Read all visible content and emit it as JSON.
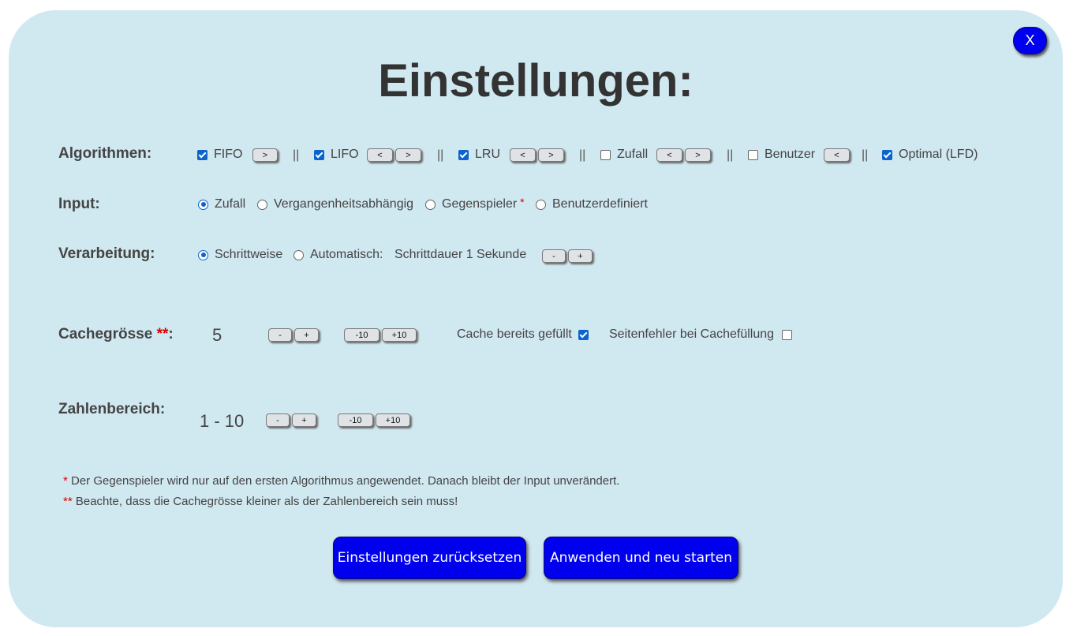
{
  "dialog": {
    "close_label": "X",
    "title": "Einstellungen:"
  },
  "algorithms": {
    "label": "Algorithmen:",
    "separator": "||",
    "items": [
      {
        "label": "FIFO",
        "checked": true,
        "buttons": [
          ">"
        ]
      },
      {
        "label": "LIFO",
        "checked": true,
        "buttons": [
          "<",
          ">"
        ]
      },
      {
        "label": "LRU",
        "checked": true,
        "buttons": [
          "<",
          ">"
        ]
      },
      {
        "label": "Zufall",
        "checked": false,
        "buttons": [
          "<",
          ">"
        ]
      },
      {
        "label": "Benutzer",
        "checked": false,
        "buttons": [
          "<"
        ]
      },
      {
        "label": "Optimal (LFD)",
        "checked": true,
        "buttons": []
      }
    ]
  },
  "input": {
    "label": "Input:",
    "options": [
      {
        "label": "Zufall",
        "selected": true
      },
      {
        "label": "Vergangenheitsabhängig",
        "selected": false
      },
      {
        "label": "Gegenspieler",
        "selected": false,
        "marker": "*"
      },
      {
        "label": "Benutzerdefiniert",
        "selected": false
      }
    ]
  },
  "processing": {
    "label": "Verarbeitung:",
    "options": [
      {
        "label": "Schrittweise",
        "selected": true
      },
      {
        "label": "Automatisch:",
        "selected": false
      }
    ],
    "step_duration": "Schrittdauer 1 Sekunde",
    "minus": "-",
    "plus": "+"
  },
  "cache": {
    "label": "Cachegrösse",
    "marker": "**",
    "colon": ":",
    "value": "5",
    "minus": "-",
    "plus": "+",
    "minus10": "-10",
    "plus10": "+10",
    "prefilled_label": "Cache bereits gefüllt",
    "prefilled_checked": true,
    "pagefault_label": "Seitenfehler bei Cachefüllung",
    "pagefault_checked": false
  },
  "range": {
    "label": "Zahlenbereich:",
    "value": "1 - 10",
    "minus": "-",
    "plus": "+",
    "minus10": "-10",
    "plus10": "+10"
  },
  "notes": {
    "note1_marker": "*",
    "note1_text": " Der Gegenspieler wird nur auf den ersten Algorithmus angewendet. Danach bleibt der Input unverändert.",
    "note2_marker": "**",
    "note2_text": " Beachte, dass die Cachegrösse kleiner als der Zahlenbereich sein muss!"
  },
  "actions": {
    "reset_label": "Einstellungen zurücksetzen",
    "apply_label": "Anwenden und neu starten"
  },
  "colors": {
    "dialog_background": "#d0e8f0",
    "primary_button": "#0000ee",
    "checkbox_accent": "#0b63ce",
    "required_marker": "#dd0000"
  }
}
